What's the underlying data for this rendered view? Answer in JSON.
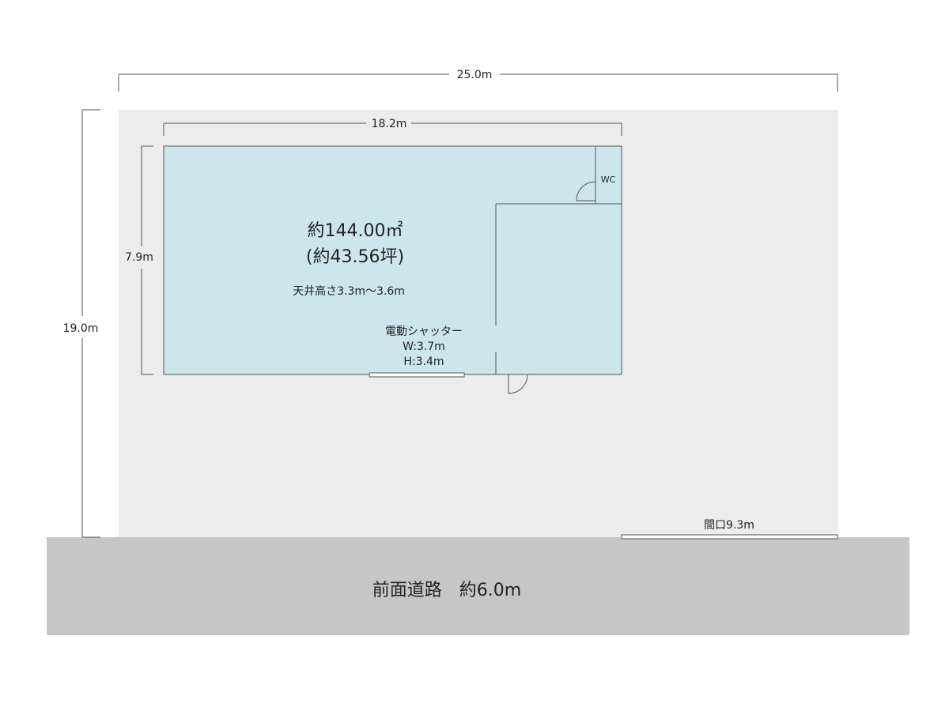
{
  "dimensions": {
    "lot_width": "25.0m",
    "lot_depth": "19.0m",
    "building_width": "18.2m",
    "building_depth": "7.9m",
    "frontage": "間口9.3m"
  },
  "building": {
    "area_sqm": "約144.00㎡",
    "area_tsubo": "(約43.56坪)",
    "ceiling_height": "天井高さ3.3m〜3.6m",
    "shutter_title": "電動シャッター",
    "shutter_width": "W:3.7m",
    "shutter_height": "H:3.4m",
    "wc_label": "WC"
  },
  "road": {
    "label": "前面道路　約6.0m"
  },
  "colors": {
    "lot_fill": "#ececec",
    "building_fill": "#cde5ed",
    "road_fill": "#c6c6c6",
    "line": "#555555"
  }
}
